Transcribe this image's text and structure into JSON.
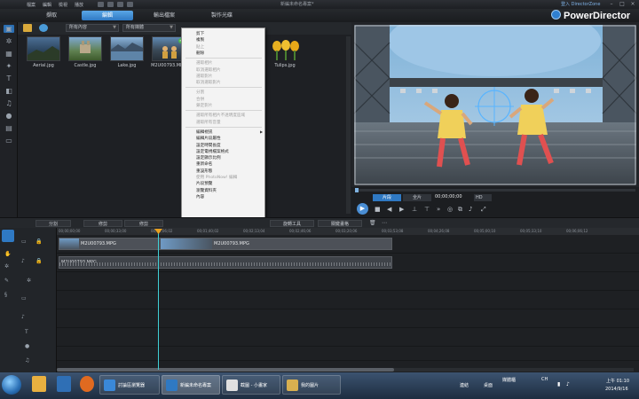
{
  "app": {
    "menus": [
      "檔案",
      "編輯",
      "檢視",
      "播放"
    ],
    "doc_title": "新編未命名專案*",
    "login_link": "登入 DirectorZone",
    "brand": "PowerDirector"
  },
  "mode_tabs": [
    "擷取",
    "編輯",
    "輸出檔案",
    "製作光碟"
  ],
  "active_mode": "編輯",
  "library": {
    "filter_dropdown": "所有內容",
    "view_dropdown": "所有媒體",
    "items": [
      {
        "name": "Aerial.jpg"
      },
      {
        "name": "Castle.jpg"
      },
      {
        "name": "Lake.jpg"
      },
      {
        "name": "M2U00793.MPG"
      },
      {
        "name": "Tulips.jpg"
      }
    ]
  },
  "context_menu": {
    "groups": [
      [
        {
          "label": "剪下",
          "enabled": true
        },
        {
          "label": "複製",
          "enabled": true
        },
        {
          "label": "貼上",
          "enabled": false
        },
        {
          "label": "刪除",
          "enabled": true
        }
      ],
      [
        {
          "label": "選取相片",
          "enabled": false
        },
        {
          "label": "取消選取相片",
          "enabled": false
        },
        {
          "label": "選取影片",
          "enabled": false
        },
        {
          "label": "取消選取影片",
          "enabled": false
        }
      ],
      [
        {
          "label": "分割",
          "enabled": false
        },
        {
          "label": "合併",
          "enabled": false
        },
        {
          "label": "鎖定影片",
          "enabled": false
        }
      ],
      [
        {
          "label": "選取所有相片不透明度區域",
          "enabled": false
        },
        {
          "label": "選取所有音量",
          "enabled": false
        }
      ],
      [
        {
          "label": "編輯視訊",
          "enabled": true,
          "submenu": true
        },
        {
          "label": "編輯片段屬性",
          "enabled": true
        },
        {
          "label": "設定時間長度",
          "enabled": true
        },
        {
          "label": "設定電視檔案格式",
          "enabled": true
        },
        {
          "label": "設定顯示比例",
          "enabled": true
        },
        {
          "label": "重新命名",
          "enabled": true
        },
        {
          "label": "重設形態",
          "enabled": true
        },
        {
          "label": "使用 PhotoNow! 編輯",
          "enabled": false
        },
        {
          "label": "片段預覽",
          "enabled": true
        },
        {
          "label": "瀏覽資料夾",
          "enabled": true
        },
        {
          "label": "內容",
          "enabled": true
        }
      ]
    ]
  },
  "preview": {
    "tab_clip": "片段",
    "tab_movie": "全片",
    "timecode": "00;00;00;00",
    "quality": "HD"
  },
  "timeline": {
    "toolbar": [
      "分割",
      "修剪",
      "修剪",
      "旋轉工具",
      "關鍵畫格"
    ],
    "ruler": [
      "00;00;00;00",
      "00;00;33;00",
      "00;01;06;02",
      "00;01;40;02",
      "00;02;13;04",
      "00;02;46;06",
      "00;03;20;06",
      "00;03;53;08",
      "00;04;26;08",
      "00;05;00;10",
      "00;05;33;10",
      "00;06;06;12"
    ],
    "video_clip": "M2U00793.MPG",
    "audio_clip": "M2U00793.MPG"
  },
  "taskbar": {
    "items": [
      "討論區瀏覽器",
      "新編未命名專案",
      "截圖 - 小畫家",
      "我的圖片"
    ],
    "tray_left": "連結",
    "tray_desktop": "桌面",
    "tray_recent": "媒體櫃",
    "tray_lang": "CH",
    "time": "上午 01:10",
    "date": "2014/9/16"
  },
  "colors": {
    "accent": "#2f79c3",
    "playhead": "#3fd0d6"
  }
}
